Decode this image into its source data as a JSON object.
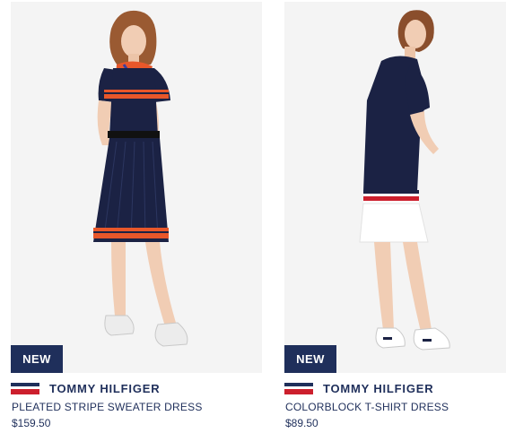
{
  "products": [
    {
      "badge": "NEW",
      "brand": "TOMMY HILFIGER",
      "name": "PLEATED STRIPE SWEATER DRESS",
      "price": "$159.50",
      "image_subject": "model-in-pleated-stripe-sweater-dress"
    },
    {
      "badge": "NEW",
      "brand": "TOMMY HILFIGER",
      "name": "COLORBLOCK T-SHIRT DRESS",
      "price": "$89.50",
      "image_subject": "model-in-colorblock-t-shirt-dress"
    }
  ],
  "colors": {
    "navy": "#1f2f5b",
    "red": "#cc1f2d",
    "orange": "#e8572a",
    "background": "#f4f4f4"
  }
}
